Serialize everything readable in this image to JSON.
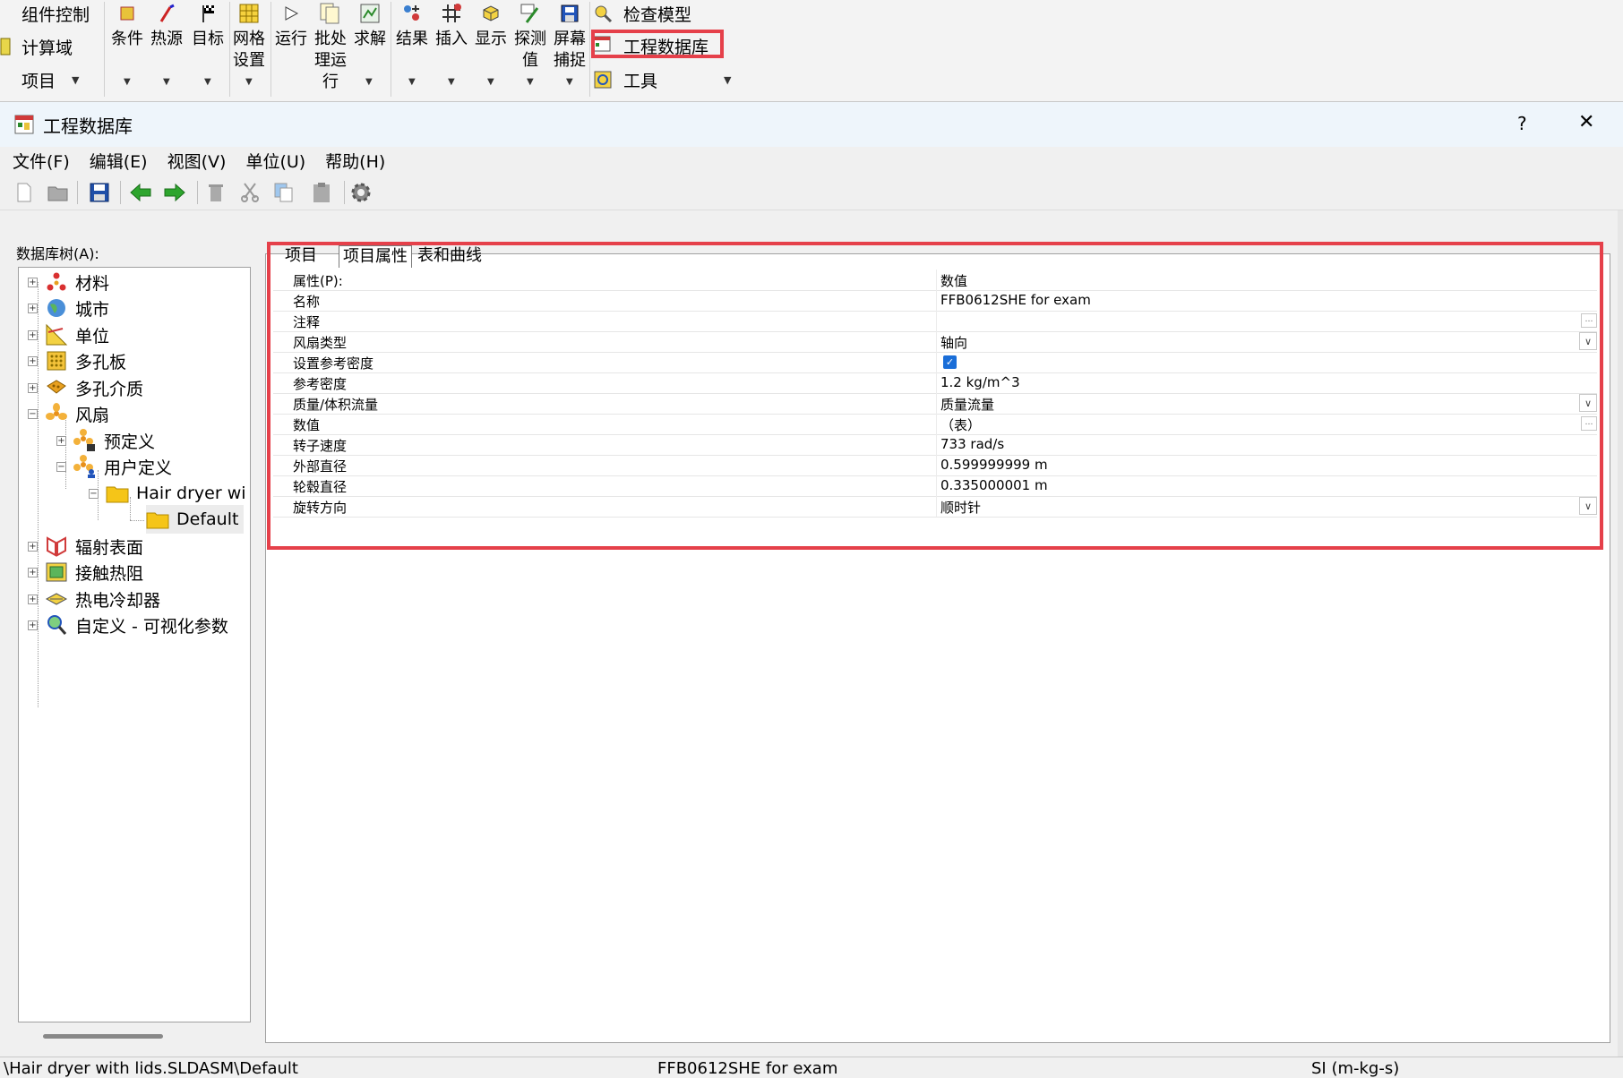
{
  "ribbon": {
    "left_items": [
      "组件控制",
      "计算域",
      "项目"
    ],
    "buttons": [
      {
        "label": "条件",
        "icon": "condition-icon"
      },
      {
        "label": "热源",
        "icon": "heat-source-icon"
      },
      {
        "label": "目标",
        "icon": "goal-flag-icon"
      },
      {
        "label": "网格\n设置",
        "icon": "mesh-icon"
      },
      {
        "label": "运行",
        "icon": "run-icon"
      },
      {
        "label": "批处\n理运\n行",
        "icon": "batch-run-icon"
      },
      {
        "label": "求解",
        "icon": "solve-icon"
      },
      {
        "label": "结果",
        "icon": "results-icon"
      },
      {
        "label": "插入",
        "icon": "insert-icon"
      },
      {
        "label": "显示",
        "icon": "display-icon"
      },
      {
        "label": "探测\n值",
        "icon": "probe-icon"
      },
      {
        "label": "屏幕\n捕捉",
        "icon": "screen-capture-icon"
      }
    ],
    "right_items": [
      "检查模型",
      "工程数据库",
      "工具"
    ]
  },
  "dialog": {
    "title": "工程数据库",
    "help": "?",
    "close": "✕",
    "menu": [
      "文件(F)",
      "编辑(E)",
      "视图(V)",
      "单位(U)",
      "帮助(H)"
    ]
  },
  "tree": {
    "label": "数据库树(A):",
    "items": {
      "materials": "材料",
      "cities": "城市",
      "units": "单位",
      "perforated_plates": "多孔板",
      "porous_media": "多孔介质",
      "fans": "风扇",
      "predefined": "预定义",
      "user_defined": "用户定义",
      "hair_dryer": "Hair dryer wi",
      "default": "Default",
      "radiative_surfaces": "辐射表面",
      "contact_resistance": "接触热阻",
      "thermoelectric_coolers": "热电冷却器",
      "custom_visualization": "自定义 - 可视化参数"
    }
  },
  "tabs": [
    "项目",
    "项目属性",
    "表和曲线"
  ],
  "properties": {
    "header": {
      "name": "属性(P):",
      "value": "数值"
    },
    "rows": [
      {
        "name": "名称",
        "value": "FFB0612SHE for exam"
      },
      {
        "name": "注释",
        "value": ""
      },
      {
        "name": "风扇类型",
        "value": "轴向"
      },
      {
        "name": "设置参考密度",
        "value": ""
      },
      {
        "name": "参考密度",
        "value": "1.2 kg/m^3"
      },
      {
        "name": "质量/体积流量",
        "value": "质量流量"
      },
      {
        "name": "数值",
        "value": "（表）"
      },
      {
        "name": "转子速度",
        "value": "733 rad/s"
      },
      {
        "name": "外部直径",
        "value": "0.599999999 m"
      },
      {
        "name": "轮毂直径",
        "value": "0.335000001 m"
      },
      {
        "name": "旋转方向",
        "value": "顺时针"
      }
    ]
  },
  "status": {
    "path": "\\Hair dryer with lids.SLDASM\\Default",
    "item": "FFB0612SHE for exam",
    "units": "SI (m-kg-s)"
  },
  "colors": {
    "highlight": "#e5404a",
    "checkbox": "#1a6ed8",
    "titlebar": "#eef5fb"
  }
}
